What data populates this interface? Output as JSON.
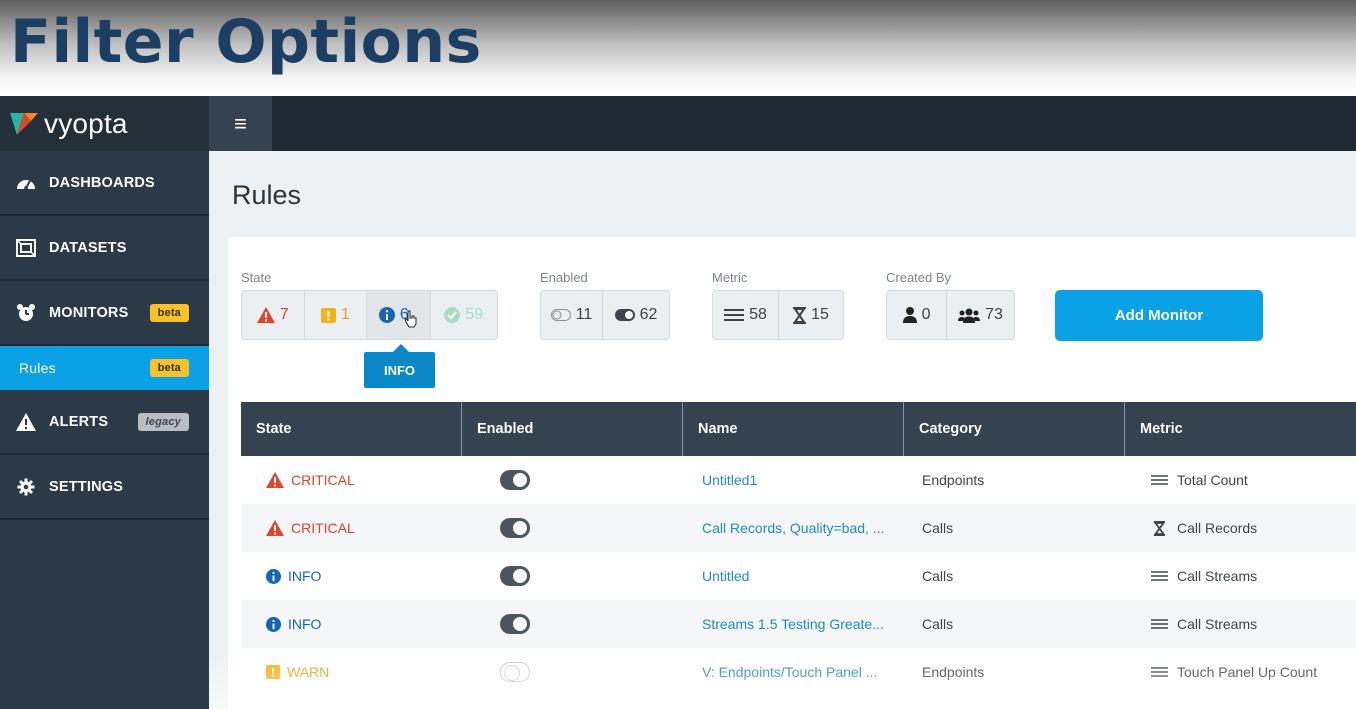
{
  "banner": {
    "title": "Filter Options"
  },
  "brand": {
    "name": "vyopta",
    "colors": {
      "teal": "#2bb3a3",
      "orange": "#f08a24",
      "red": "#e0452b"
    }
  },
  "sidebar": {
    "items": [
      {
        "label": "DASHBOARDS",
        "icon": "dashboard-gauge-icon"
      },
      {
        "label": "DATASETS",
        "icon": "dataset-icon"
      },
      {
        "label": "MONITORS",
        "icon": "monitor-alarm-icon",
        "badge": "beta"
      },
      {
        "label": "Rules",
        "badge": "beta",
        "active": true
      },
      {
        "label": "ALERTS",
        "icon": "alert-triangle-icon",
        "badge": "legacy"
      },
      {
        "label": "SETTINGS",
        "icon": "gear-icon"
      }
    ]
  },
  "topbar": {
    "menu_icon": "hamburger-icon",
    "menu_glyph": "≡"
  },
  "page": {
    "title": "Rules"
  },
  "filters": {
    "state": {
      "label": "State",
      "critical": "7",
      "warn": "1",
      "info": "6",
      "ok": "59"
    },
    "enabled": {
      "label": "Enabled",
      "disabled_count": "11",
      "enabled_count": "62"
    },
    "metric": {
      "label": "Metric",
      "count_metric": "58",
      "timed_metric": "15"
    },
    "created_by": {
      "label": "Created By",
      "me": "0",
      "everyone": "73"
    },
    "tooltip": "INFO"
  },
  "add_button": {
    "label": "Add Monitor"
  },
  "table": {
    "headers": [
      "State",
      "Enabled",
      "Name",
      "Category",
      "Metric"
    ],
    "rows": [
      {
        "state": "CRITICAL",
        "level": "critical",
        "enabled": true,
        "name": "Untitled1",
        "category": "Endpoints",
        "metric": "Total Count",
        "metric_icon": "count-lines-icon"
      },
      {
        "state": "CRITICAL",
        "level": "critical",
        "enabled": true,
        "name": "Call Records, Quality=bad, ...",
        "category": "Calls",
        "metric": "Call Records",
        "metric_icon": "hourglass-icon"
      },
      {
        "state": "INFO",
        "level": "info",
        "enabled": true,
        "name": "Untitled",
        "category": "Calls",
        "metric": "Call Streams",
        "metric_icon": "count-lines-icon"
      },
      {
        "state": "INFO",
        "level": "info",
        "enabled": true,
        "name": "Streams 1.5 Testing Greate...",
        "category": "Calls",
        "metric": "Call Streams",
        "metric_icon": "count-lines-icon"
      },
      {
        "state": "WARN",
        "level": "warn",
        "enabled": false,
        "name": "V: Endpoints/Touch Panel ...",
        "category": "Endpoints",
        "metric": "Touch Panel Up Count",
        "metric_icon": "count-lines-icon"
      }
    ]
  }
}
